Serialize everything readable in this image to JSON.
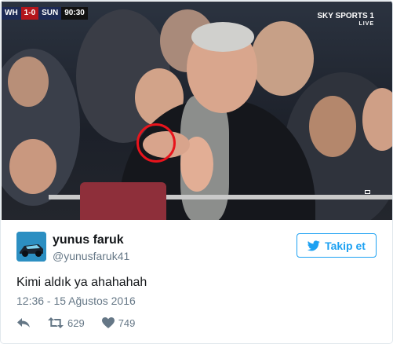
{
  "media": {
    "scoreboard": {
      "home_team": "WH",
      "score": "1-0",
      "away_team": "SUN",
      "clock": "90:30"
    },
    "broadcaster": {
      "name": "SKY SPORTS 1",
      "tag": "LIVE"
    }
  },
  "tweet": {
    "display_name": "yunus faruk",
    "screen_name": "@yunusfaruk41",
    "follow_label": "Takip et",
    "text": "Kimi aldık ya ahahahah",
    "timestamp": "12:36 - 15 Ağustos 2016",
    "retweet_count": "629",
    "like_count": "749"
  },
  "colors": {
    "accent": "#1da1f2",
    "text": "#14171a",
    "muted": "#657786",
    "border": "#e1e8ed",
    "highlight": "#e8141c"
  },
  "icons": {
    "follow": "twitter-bird-icon",
    "reply": "reply-icon",
    "retweet": "retweet-icon",
    "like": "heart-icon"
  }
}
